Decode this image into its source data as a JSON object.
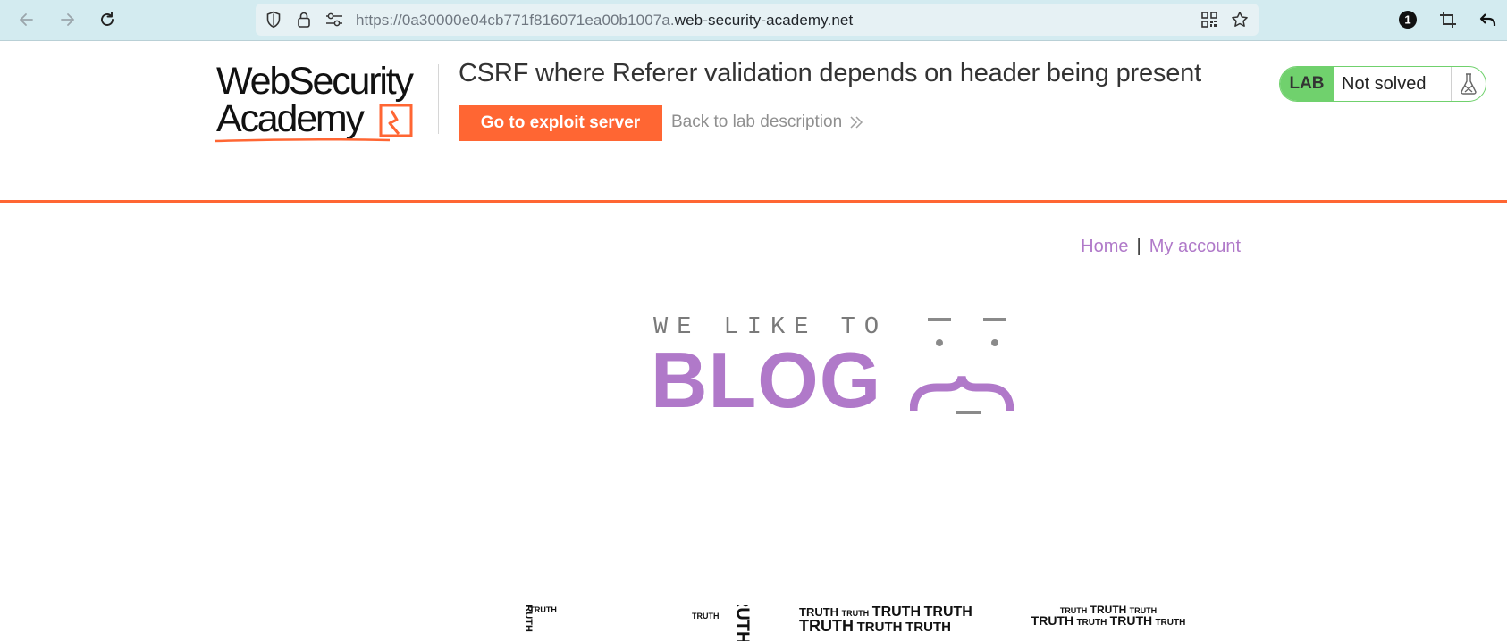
{
  "browser": {
    "url_prefix": "https://0a30000e04cb771f816071ea00b1007a.",
    "url_domain": "web-security-academy.net",
    "notification_count": "1",
    "icons": [
      "back-arrow-icon",
      "forward-arrow-icon",
      "reload-icon",
      "shield-icon",
      "lock-icon",
      "permissions-icon",
      "qr-code-icon",
      "star-icon",
      "notification-icon",
      "crop-icon",
      "undo-icon"
    ]
  },
  "lab": {
    "logo_line1": "WebSecurity",
    "logo_line2": "Academy",
    "title": "CSRF where Referer validation depends on header being present",
    "exploit_button": "Go to exploit server",
    "back_link": "Back to lab description",
    "badge": "LAB",
    "status": "Not solved"
  },
  "nav": {
    "home": "Home",
    "separator": "|",
    "account": "My account"
  },
  "banner": {
    "small_text": "WE LIKE TO",
    "big_text": "BLOG"
  },
  "thumbnails": {
    "word": "TRUTH"
  },
  "colors": {
    "accent_orange": "#ff6633",
    "status_green": "#70d16d",
    "link_purple": "#b079c9",
    "toolbar_bg": "#d3ebf0"
  }
}
